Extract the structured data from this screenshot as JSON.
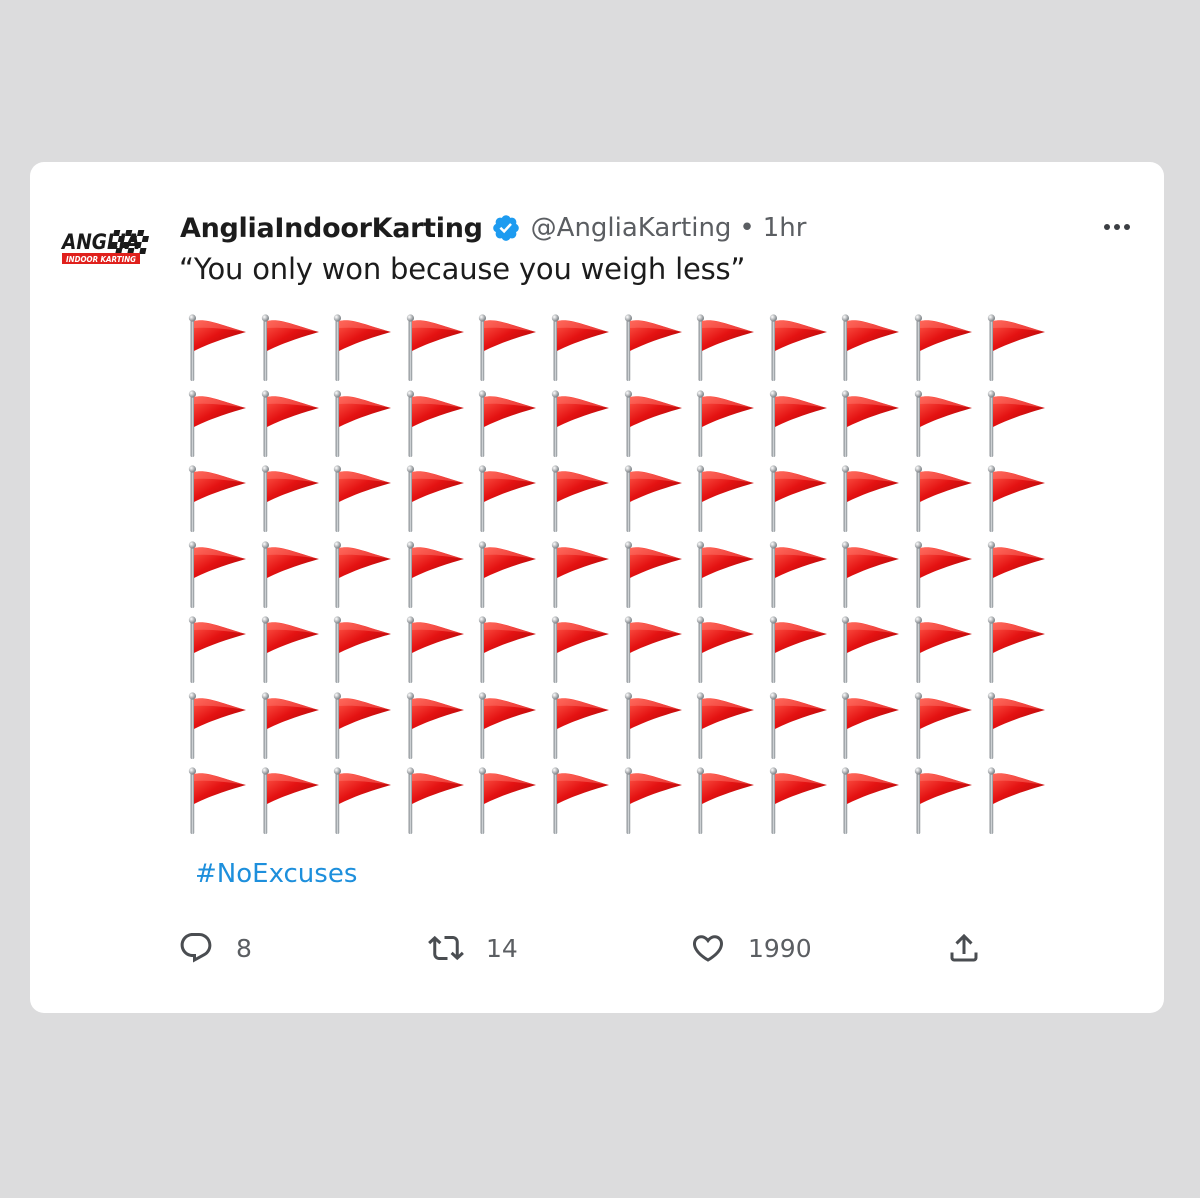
{
  "author": {
    "display_name": "AngliaIndoorKarting",
    "handle": "@AngliaKarting",
    "separator": "•",
    "time": "1hr",
    "verified": true,
    "logo": {
      "line1": "ANGLIA",
      "line2": "INDOOR KARTING",
      "colors": {
        "primary": "#1a1a1a",
        "accent": "#e0201c"
      }
    }
  },
  "tweet": {
    "text": "“You only won because you weigh less”",
    "flag_rows": 7,
    "flag_columns": 12,
    "flag_icon": "red-triangular-flag",
    "hashtag": "#NoExcuses"
  },
  "actions": {
    "reply": {
      "icon": "comment-icon",
      "count": "8"
    },
    "retweet": {
      "icon": "retweet-icon",
      "count": "14"
    },
    "like": {
      "icon": "heart-icon",
      "count": "1990"
    },
    "share": {
      "icon": "share-icon"
    }
  },
  "colors": {
    "background": "#dcdcdd",
    "card": "#ffffff",
    "link": "#1d8fdc",
    "verified": "#1d9bf0",
    "flag_red": "#e01010",
    "muted_text": "#5b5e62"
  }
}
